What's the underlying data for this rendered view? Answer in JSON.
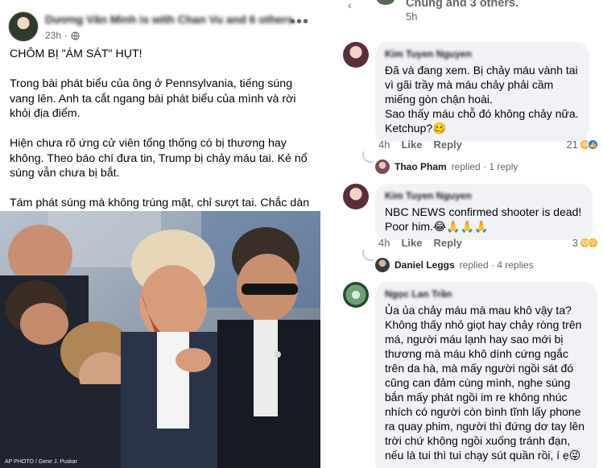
{
  "post": {
    "author": "Dương Văn Minh is with Chan Vu and 6 others.",
    "time": "23h",
    "more": "•••",
    "headline": "CHÔM BỊ \"ÁM SÁT\" HỤT!",
    "para1": "Trong bài phát biểu của ông ở Pennsylvania, tiếng súng vang lên. Anh ta cắt ngang bài phát biểu của mình và rời khỏi địa điểm.",
    "para2": "Hiện chưa rõ ứng cử viên tổng thống có bị thương hay không. Theo báo chí đưa tin, Trump bị chảy máu tai. Kẻ nổ súng vẫn chưa bị bắt.",
    "para3": "Tám phát súng mà không trúng mặt, chỉ sượt tai. Chắc dàn dựng kiếm phiếu bầu!",
    "photo_credit": "AP PHOTO / Gene J. Puskar"
  },
  "thread": {
    "top_text": "Chung and 3 others.",
    "top_time": "5h"
  },
  "comments": [
    {
      "name": "Kim Tuyen Nguyen",
      "lines": [
        "Đã và đang xem. Bị chảy máu vành tai",
        "vì gãi trầy mà máu chảy phải cầm",
        "miếng gòn chận hoài.",
        "Sao thấy máu chỗ đó không chảy nữa.",
        "Ketchup?🥴"
      ],
      "time": "4h",
      "like": "Like",
      "reply": "Reply",
      "reactions": "21",
      "reply_by": "Thao Pham",
      "reply_info": "replied · 1 reply"
    },
    {
      "name": "Kim Tuyen Nguyen",
      "lines": [
        "NBC NEWS confirmed shooter is dead!",
        "Poor him.😂🙏🙏🙏"
      ],
      "time": "4h",
      "like": "Like",
      "reply": "Reply",
      "reactions": "3",
      "reply_by": "Daniel Leggs",
      "reply_info": "replied · 4 replies"
    },
    {
      "name": "Ngọc Lan Trần",
      "lines": [
        "Ủa ủa chảy máu mà mau khô vậy ta?",
        "Không thấy nhỏ giọt hay chảy ròng trên",
        "má, người máu lạnh hay sao mới bị",
        "thương mà máu khô dính cứng ngắc",
        "trên da hà, mà mấy người ngồi sát đó",
        "cũng can đảm cùng mình, nghe súng",
        "bắn mấy phát ngồi im re không nhúc",
        "nhích có người còn bình tĩnh lấy phone",
        "ra quay phim, người thì đứng dơ tay lên",
        "trời chứ không ngồi xuống tránh đạn,",
        "nếu là tui thì tui chạy sút quần rồi, í ẹ😜"
      ]
    }
  ]
}
